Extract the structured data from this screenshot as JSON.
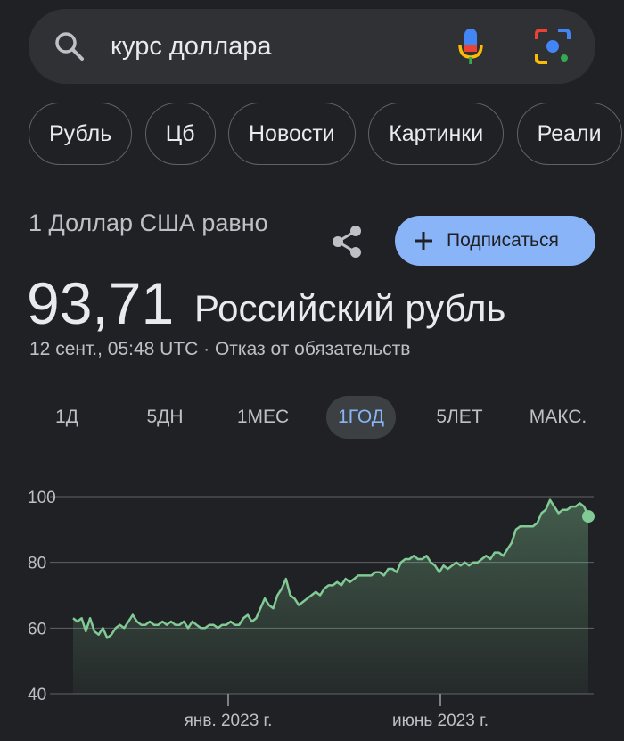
{
  "search": {
    "query": "курс доллара"
  },
  "chips": [
    "Рубль",
    "Цб",
    "Новости",
    "Картинки",
    "Реали"
  ],
  "converter": {
    "from_label": "1 Доллар США равно",
    "subscribe_label": "Подписаться",
    "value": "93,71",
    "currency": "Российский рубль",
    "timestamp": "12 сент., 05:48 UTC · Отказ от обязательств"
  },
  "ranges": [
    "1Д",
    "5ДН",
    "1МЕС",
    "1ГОД",
    "5ЛЕТ",
    "МАКС."
  ],
  "active_range": "1ГОД",
  "colors": {
    "accent": "#8ab4f8",
    "line": "#81c995",
    "background": "#202124"
  },
  "chart_data": {
    "type": "area",
    "x_ticks": [
      "янв. 2023 г.",
      "июнь 2023 г."
    ],
    "y_ticks": [
      100,
      80,
      60,
      40
    ],
    "ylim": [
      40,
      100
    ],
    "series": [
      {
        "values": [
          63,
          62,
          63,
          59,
          63,
          59,
          58,
          60,
          57,
          58,
          60,
          61,
          60,
          62,
          64,
          62,
          61,
          61,
          62,
          61,
          61,
          62,
          61,
          62,
          61,
          61,
          62,
          60,
          62,
          61,
          60,
          60,
          61,
          61,
          60,
          61,
          61,
          62,
          61,
          61,
          63,
          64,
          62,
          63,
          66,
          69,
          67,
          66,
          70,
          72,
          75,
          70,
          69,
          67,
          68,
          69,
          70,
          71,
          70,
          72,
          73,
          73,
          74,
          73,
          75,
          74,
          75,
          76,
          76,
          76,
          76,
          77,
          77,
          76,
          78,
          78,
          77,
          80,
          81,
          81,
          82,
          81,
          81,
          82,
          80,
          79,
          77,
          79,
          78,
          79,
          80,
          79,
          80,
          79,
          80,
          80,
          81,
          82,
          81,
          83,
          83,
          82,
          84,
          86,
          90,
          91,
          91,
          91,
          91,
          92,
          95,
          96,
          99,
          97,
          95,
          96,
          96,
          97,
          97,
          98,
          97,
          94
        ]
      }
    ]
  }
}
